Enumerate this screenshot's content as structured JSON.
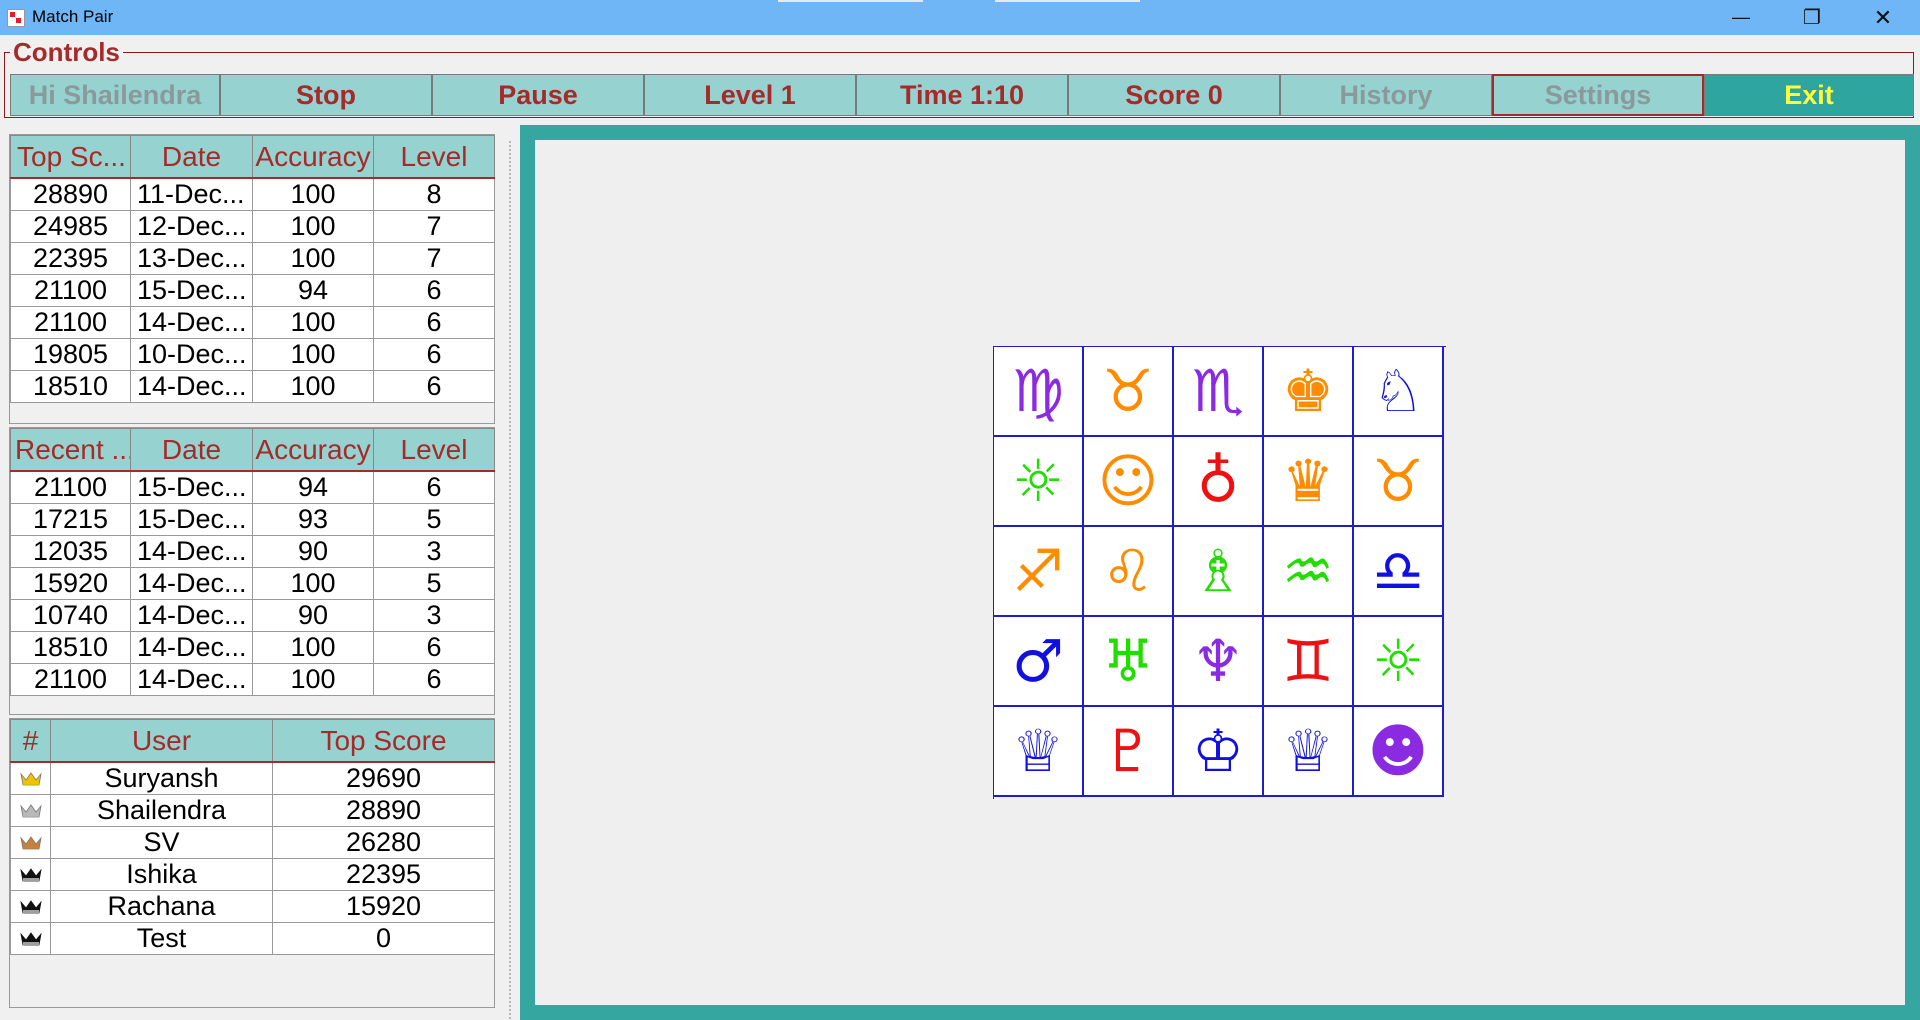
{
  "window": {
    "title": "Match Pair",
    "minimize_glyph": "—",
    "maximize_glyph": "❐",
    "close_glyph": "✕"
  },
  "controls": {
    "legend": "Controls",
    "buttons": [
      {
        "label": "Hi Shailendra",
        "state": "disabled"
      },
      {
        "label": "Stop",
        "state": "enabled"
      },
      {
        "label": "Pause",
        "state": "enabled"
      },
      {
        "label": "Level 1",
        "state": "enabled"
      },
      {
        "label": "Time 1:10",
        "state": "enabled"
      },
      {
        "label": "Score 0",
        "state": "enabled"
      },
      {
        "label": "History",
        "state": "disabled"
      },
      {
        "label": "Settings",
        "state": "disabled-focused"
      },
      {
        "label": "Exit",
        "state": "enabled"
      }
    ]
  },
  "top_scores": {
    "headers": [
      "Top Sc...",
      "Date",
      "Accuracy",
      "Level"
    ],
    "rows": [
      [
        "28890",
        "11-Dec...",
        "100",
        "8"
      ],
      [
        "24985",
        "12-Dec...",
        "100",
        "7"
      ],
      [
        "22395",
        "13-Dec...",
        "100",
        "7"
      ],
      [
        "21100",
        "15-Dec...",
        "94",
        "6"
      ],
      [
        "21100",
        "14-Dec...",
        "100",
        "6"
      ],
      [
        "19805",
        "10-Dec...",
        "100",
        "6"
      ],
      [
        "18510",
        "14-Dec...",
        "100",
        "6"
      ]
    ]
  },
  "recent_scores": {
    "headers": [
      "Recent ...",
      "Date",
      "Accuracy",
      "Level"
    ],
    "rows": [
      [
        "21100",
        "15-Dec...",
        "94",
        "6"
      ],
      [
        "17215",
        "15-Dec...",
        "93",
        "5"
      ],
      [
        "12035",
        "14-Dec...",
        "90",
        "3"
      ],
      [
        "15920",
        "14-Dec...",
        "100",
        "5"
      ],
      [
        "10740",
        "14-Dec...",
        "90",
        "3"
      ],
      [
        "18510",
        "14-Dec...",
        "100",
        "6"
      ],
      [
        "21100",
        "14-Dec...",
        "100",
        "6"
      ]
    ]
  },
  "leaderboard": {
    "headers": [
      "#",
      "User",
      "Top Score"
    ],
    "rows": [
      {
        "crown": "gold-crown-icon",
        "crown_color": "#f2c200",
        "user": "Suryansh",
        "score": "29690"
      },
      {
        "crown": "silver-crown-icon",
        "crown_color": "#b9b9b9",
        "user": "Shailendra",
        "score": "28890"
      },
      {
        "crown": "bronze-crown-icon",
        "crown_color": "#c9803a",
        "user": "SV",
        "score": "26280"
      },
      {
        "crown": "black-crown-icon",
        "crown_color": "#111111",
        "user": "Ishika",
        "score": "22395"
      },
      {
        "crown": "black-crown-icon",
        "crown_color": "#111111",
        "user": "Rachana",
        "score": "15920"
      },
      {
        "crown": "black-crown-icon",
        "crown_color": "#111111",
        "user": "Test",
        "score": "0"
      }
    ]
  },
  "board": {
    "tiles": [
      {
        "icon": "virgo-icon",
        "glyph": "♍",
        "color": "#8a2be2"
      },
      {
        "icon": "taurus-icon",
        "glyph": "♉",
        "color": "#ff8c00"
      },
      {
        "icon": "scorpio-icon",
        "glyph": "♏",
        "color": "#8a2be2"
      },
      {
        "icon": "chess-king-icon",
        "glyph": "♚",
        "color": "#ff8c00"
      },
      {
        "icon": "chess-knight-icon",
        "glyph": "♘",
        "color": "#1010e0"
      },
      {
        "icon": "sun-icon",
        "glyph": "☼",
        "color": "#22dd00"
      },
      {
        "icon": "smiley-icon",
        "glyph": "☺",
        "color": "#ff8c00"
      },
      {
        "icon": "earth-symbol-icon",
        "glyph": "♁",
        "color": "#ee1111"
      },
      {
        "icon": "chess-queen-icon",
        "glyph": "♛",
        "color": "#ff8c00"
      },
      {
        "icon": "taurus-icon",
        "glyph": "♉",
        "color": "#ff8c00"
      },
      {
        "icon": "sagittarius-icon",
        "glyph": "♐",
        "color": "#ff8c00"
      },
      {
        "icon": "leo-icon",
        "glyph": "♌",
        "color": "#ff8c00"
      },
      {
        "icon": "chess-bishop-icon",
        "glyph": "♗",
        "color": "#22dd00"
      },
      {
        "icon": "aquarius-icon",
        "glyph": "♒",
        "color": "#22dd00"
      },
      {
        "icon": "libra-icon",
        "glyph": "♎",
        "color": "#1010e0"
      },
      {
        "icon": "mars-icon",
        "glyph": "♂",
        "color": "#1010e0"
      },
      {
        "icon": "uranus-icon",
        "glyph": "♅",
        "color": "#22dd00"
      },
      {
        "icon": "neptune-icon",
        "glyph": "♆",
        "color": "#8a2be2"
      },
      {
        "icon": "gemini-icon",
        "glyph": "♊",
        "color": "#ee1111"
      },
      {
        "icon": "sun-icon",
        "glyph": "☼",
        "color": "#22dd00"
      },
      {
        "icon": "chess-queen-icon",
        "glyph": "♕",
        "color": "#1010e0"
      },
      {
        "icon": "pluto-icon",
        "glyph": "♇",
        "color": "#ee1111"
      },
      {
        "icon": "chess-king-icon",
        "glyph": "♔",
        "color": "#1010e0"
      },
      {
        "icon": "chess-queen-icon",
        "glyph": "♕",
        "color": "#1010e0"
      },
      {
        "icon": "smiley-filled-icon",
        "glyph": "☻",
        "color": "#8a2be2"
      }
    ]
  }
}
